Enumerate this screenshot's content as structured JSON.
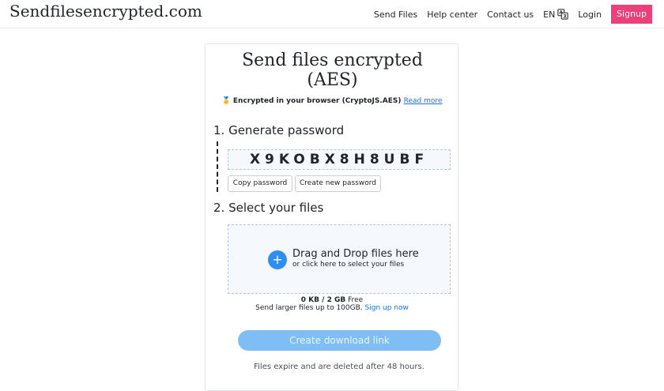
{
  "nav": {
    "brand": "Sendfilesencrypted.com",
    "links": [
      "Send Files",
      "Help center",
      "Contact us"
    ],
    "language": "EN",
    "login": "Login",
    "signup": "Signup"
  },
  "card": {
    "title_line1": "Send files encrypted",
    "title_line2": "(AES)",
    "subtitle_emoji": "🥇",
    "subtitle": "Encrypted in your browser (CryptoJS.AES)",
    "read_more": "Read more",
    "step1_title": "1. Generate password",
    "password": "X9KOBX8H8UBF",
    "copy_button": "Copy password",
    "create_password_button": "Create new password",
    "step2_title": "2. Select your files",
    "dropzone_main": "Drag and Drop files here",
    "dropzone_sub": "or click here to select your files",
    "dropzone_icon": "+",
    "usage_amount": "0 KB / 2 GB",
    "usage_suffix": "Free",
    "larger_files_text": "Send larger files up to 100GB.",
    "signup_now": "Sign up now",
    "create_link_button": "Create download link",
    "expire_text": "Files expire and are deleted after 48 hours."
  },
  "colors": {
    "signup_bg": "#ec407a",
    "link": "#1a73e8",
    "primary_button": "#7fbef5",
    "plus_circle": "#2f8ff0"
  },
  "icons": [
    "translate-icon",
    "plus-icon"
  ]
}
